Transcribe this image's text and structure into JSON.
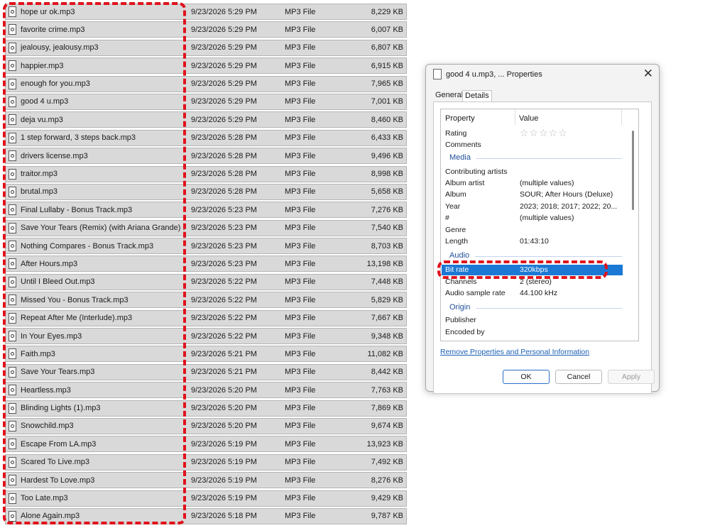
{
  "files": [
    {
      "name": "hope ur ok.mp3",
      "date": "9/23/2026 5:29 PM",
      "type": "MP3 File",
      "size": "8,229 KB"
    },
    {
      "name": "favorite crime.mp3",
      "date": "9/23/2026 5:29 PM",
      "type": "MP3 File",
      "size": "6,007 KB"
    },
    {
      "name": "jealousy, jealousy.mp3",
      "date": "9/23/2026 5:29 PM",
      "type": "MP3 File",
      "size": "6,807 KB"
    },
    {
      "name": "happier.mp3",
      "date": "9/23/2026 5:29 PM",
      "type": "MP3 File",
      "size": "6,915 KB"
    },
    {
      "name": "enough for you.mp3",
      "date": "9/23/2026 5:29 PM",
      "type": "MP3 File",
      "size": "7,965 KB"
    },
    {
      "name": "good 4 u.mp3",
      "date": "9/23/2026 5:29 PM",
      "type": "MP3 File",
      "size": "7,001 KB"
    },
    {
      "name": "deja vu.mp3",
      "date": "9/23/2026 5:29 PM",
      "type": "MP3 File",
      "size": "8,460 KB"
    },
    {
      "name": "1 step forward, 3 steps back.mp3",
      "date": "9/23/2026 5:28 PM",
      "type": "MP3 File",
      "size": "6,433 KB"
    },
    {
      "name": "drivers license.mp3",
      "date": "9/23/2026 5:28 PM",
      "type": "MP3 File",
      "size": "9,496 KB"
    },
    {
      "name": "traitor.mp3",
      "date": "9/23/2026 5:28 PM",
      "type": "MP3 File",
      "size": "8,998 KB"
    },
    {
      "name": "brutal.mp3",
      "date": "9/23/2026 5:28 PM",
      "type": "MP3 File",
      "size": "5,658 KB"
    },
    {
      "name": "Final Lullaby - Bonus Track.mp3",
      "date": "9/23/2026 5:23 PM",
      "type": "MP3 File",
      "size": "7,276 KB"
    },
    {
      "name": "Save Your Tears (Remix) (with Ariana Grande) ...",
      "date": "9/23/2026 5:23 PM",
      "type": "MP3 File",
      "size": "7,540 KB"
    },
    {
      "name": "Nothing Compares - Bonus Track.mp3",
      "date": "9/23/2026 5:23 PM",
      "type": "MP3 File",
      "size": "8,703 KB"
    },
    {
      "name": "After Hours.mp3",
      "date": "9/23/2026 5:23 PM",
      "type": "MP3 File",
      "size": "13,198 KB"
    },
    {
      "name": "Until I Bleed Out.mp3",
      "date": "9/23/2026 5:22 PM",
      "type": "MP3 File",
      "size": "7,448 KB"
    },
    {
      "name": "Missed You - Bonus Track.mp3",
      "date": "9/23/2026 5:22 PM",
      "type": "MP3 File",
      "size": "5,829 KB"
    },
    {
      "name": "Repeat After Me (Interlude).mp3",
      "date": "9/23/2026 5:22 PM",
      "type": "MP3 File",
      "size": "7,667 KB"
    },
    {
      "name": "In Your Eyes.mp3",
      "date": "9/23/2026 5:22 PM",
      "type": "MP3 File",
      "size": "9,348 KB"
    },
    {
      "name": "Faith.mp3",
      "date": "9/23/2026 5:21 PM",
      "type": "MP3 File",
      "size": "11,082 KB"
    },
    {
      "name": "Save Your Tears.mp3",
      "date": "9/23/2026 5:21 PM",
      "type": "MP3 File",
      "size": "8,442 KB"
    },
    {
      "name": "Heartless.mp3",
      "date": "9/23/2026 5:20 PM",
      "type": "MP3 File",
      "size": "7,763 KB"
    },
    {
      "name": "Blinding Lights (1).mp3",
      "date": "9/23/2026 5:20 PM",
      "type": "MP3 File",
      "size": "7,869 KB"
    },
    {
      "name": "Snowchild.mp3",
      "date": "9/23/2026 5:20 PM",
      "type": "MP3 File",
      "size": "9,674 KB"
    },
    {
      "name": "Escape From LA.mp3",
      "date": "9/23/2026 5:19 PM",
      "type": "MP3 File",
      "size": "13,923 KB"
    },
    {
      "name": "Scared To Live.mp3",
      "date": "9/23/2026 5:19 PM",
      "type": "MP3 File",
      "size": "7,492 KB"
    },
    {
      "name": "Hardest To Love.mp3",
      "date": "9/23/2026 5:19 PM",
      "type": "MP3 File",
      "size": "8,276 KB"
    },
    {
      "name": "Too Late.mp3",
      "date": "9/23/2026 5:19 PM",
      "type": "MP3 File",
      "size": "9,429 KB"
    },
    {
      "name": "Alone Again.mp3",
      "date": "9/23/2026 5:18 PM",
      "type": "MP3 File",
      "size": "9,787 KB"
    }
  ],
  "dialog": {
    "title": "good 4 u.mp3, ... Properties",
    "close_label": "✕",
    "tabs": [
      "General",
      "Details"
    ],
    "columns": {
      "property": "Property",
      "value": "Value"
    },
    "rating_label": "Rating",
    "rating_stars": "☆☆☆☆☆",
    "comments_label": "Comments",
    "sections": {
      "media": "Media",
      "audio": "Audio",
      "origin": "Origin"
    },
    "media": {
      "contributing_artists": {
        "label": "Contributing artists",
        "value": ""
      },
      "album_artist": {
        "label": "Album artist",
        "value": "(multiple values)"
      },
      "album": {
        "label": "Album",
        "value": "SOUR; After Hours (Deluxe)"
      },
      "year": {
        "label": "Year",
        "value": "2023; 2018; 2017; 2022; 20..."
      },
      "number": {
        "label": "#",
        "value": "(multiple values)"
      },
      "genre": {
        "label": "Genre",
        "value": ""
      },
      "length": {
        "label": "Length",
        "value": "01:43:10"
      }
    },
    "audio": {
      "bit_rate": {
        "label": "Bit rate",
        "value": "320kbps"
      },
      "channels": {
        "label": "Channels",
        "value": "2 (stereo)"
      },
      "sample_rate": {
        "label": "Audio sample rate",
        "value": "44.100 kHz"
      }
    },
    "origin": {
      "publisher": {
        "label": "Publisher",
        "value": ""
      },
      "encoded_by": {
        "label": "Encoded by",
        "value": ""
      }
    },
    "remove_link": "Remove Properties and Personal Information",
    "buttons": {
      "ok": "OK",
      "cancel": "Cancel",
      "apply": "Apply"
    }
  },
  "colors": {
    "highlight": "#e0121c",
    "selection": "#1b78d4",
    "link": "#1a5fb4"
  }
}
